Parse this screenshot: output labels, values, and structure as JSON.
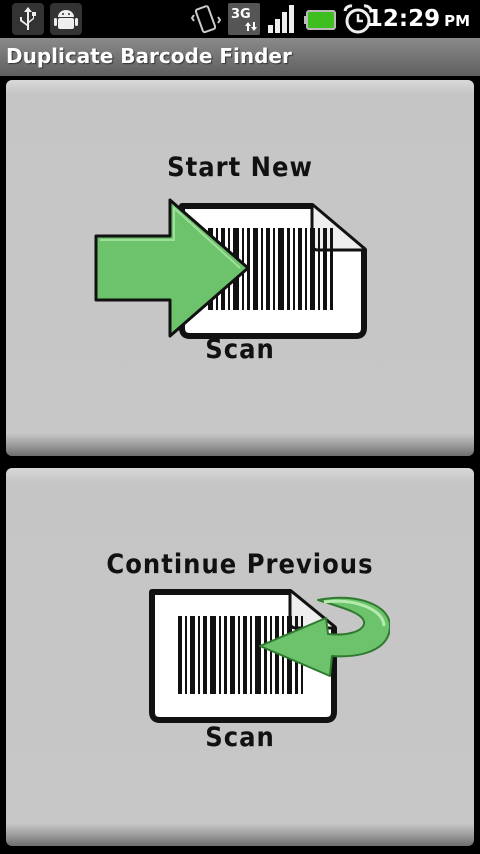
{
  "status_bar": {
    "time": "12:29",
    "ampm": "PM",
    "icons": [
      "usb-icon",
      "android-debug-icon",
      "vibrate-icon",
      "3g-data-icon",
      "signal-icon",
      "battery-icon",
      "alarm-icon"
    ]
  },
  "app": {
    "title": "Duplicate Barcode Finder"
  },
  "start_new": {
    "title": "Start New",
    "subtitle": "Scan"
  },
  "continue_previous": {
    "title": "Continue Previous",
    "subtitle": "Scan"
  },
  "colors": {
    "accent_green": "#6cc36c",
    "panel": "#c7c7c7",
    "title_bar": "#707070"
  }
}
